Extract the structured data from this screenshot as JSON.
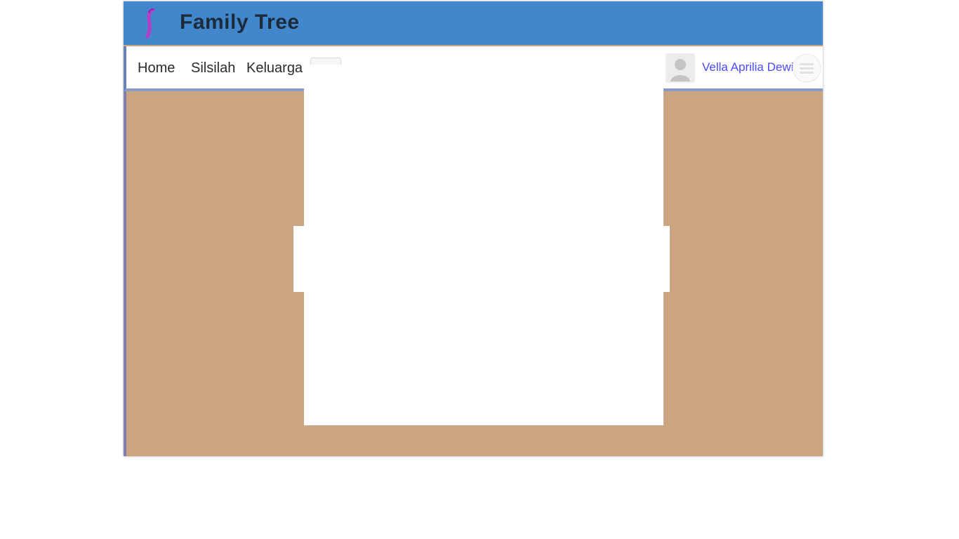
{
  "header": {
    "title": "Family Tree",
    "logo_icon": "family-tree-logo-icon",
    "background_color": "#4287cc",
    "logo_color": "#b53fc4"
  },
  "nav": {
    "items": [
      {
        "label": "Home"
      },
      {
        "label": "Silsilah"
      },
      {
        "label": "Keluarga"
      }
    ],
    "user": {
      "name": "Vella Aprilia Dewi",
      "avatar_icon": "user-avatar-icon",
      "name_color": "#4a4aff"
    },
    "menu_icon": "menu-icon"
  },
  "content": {
    "background_color": "#cba581"
  }
}
